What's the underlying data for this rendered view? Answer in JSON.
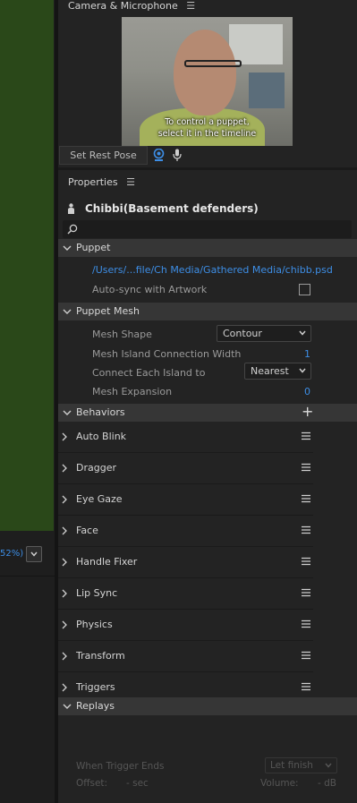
{
  "left_panel": {
    "zoom_text": "52%)",
    "zoom_button_icon": "chevron-down-icon"
  },
  "camera_panel": {
    "title": "Camera & Microphone",
    "caption_line1": "To control a puppet,",
    "caption_line2": "select it in the timeline",
    "rest_pose_label": "Set Rest Pose",
    "camera_icon": "webcam-icon",
    "mic_icon": "microphone-icon"
  },
  "properties_panel": {
    "title": "Properties",
    "puppet_name": "Chibbi(Basement defenders)",
    "search_placeholder": "",
    "puppet_section": {
      "label": "Puppet",
      "file_path": "/Users/...file/Ch Media/Gathered Media/chibb.psd",
      "autosync_label": "Auto-sync with Artwork",
      "autosync_checked": false
    },
    "mesh_section": {
      "label": "Puppet Mesh",
      "mesh_shape_label": "Mesh Shape",
      "mesh_shape_value": "Contour",
      "island_width_label": "Mesh Island Connection Width",
      "island_width_value": "1",
      "connect_label": "Connect Each Island to",
      "connect_value": "Nearest",
      "expansion_label": "Mesh Expansion",
      "expansion_value": "0"
    },
    "behaviors_section": {
      "label": "Behaviors",
      "items": [
        {
          "label": "Auto Blink"
        },
        {
          "label": "Dragger"
        },
        {
          "label": "Eye Gaze"
        },
        {
          "label": "Face"
        },
        {
          "label": "Handle Fixer"
        },
        {
          "label": "Lip Sync"
        },
        {
          "label": "Physics"
        },
        {
          "label": "Transform"
        },
        {
          "label": "Triggers"
        }
      ]
    },
    "replays_section": {
      "label": "Replays",
      "when_trigger_ends_label": "When Trigger Ends",
      "when_trigger_ends_value": "Let finish",
      "offset_label": "Offset:",
      "offset_value": "- sec",
      "volume_label": "Volume:",
      "volume_value": "- dB"
    }
  },
  "colors": {
    "accent_blue": "#3d8ee6",
    "canvas_green": "#2a4819",
    "panel_bg": "#232323",
    "section_header_bg": "#363636"
  }
}
